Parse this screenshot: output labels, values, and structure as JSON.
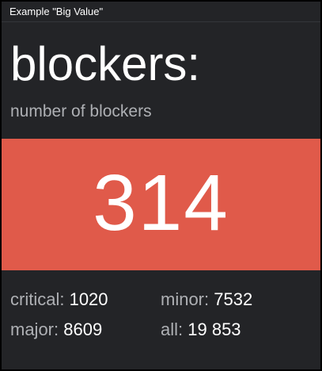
{
  "window": {
    "title": "Example \"Big Value\""
  },
  "widget": {
    "headline": "blockers:",
    "subtitle": "number of blockers",
    "big_value": "314",
    "big_value_bg": "#e05a4a",
    "stats": [
      {
        "label": "critical:",
        "value": "1020"
      },
      {
        "label": "minor:",
        "value": "7532"
      },
      {
        "label": "major:",
        "value": "8609"
      },
      {
        "label": "all:",
        "value": "19 853"
      }
    ]
  }
}
